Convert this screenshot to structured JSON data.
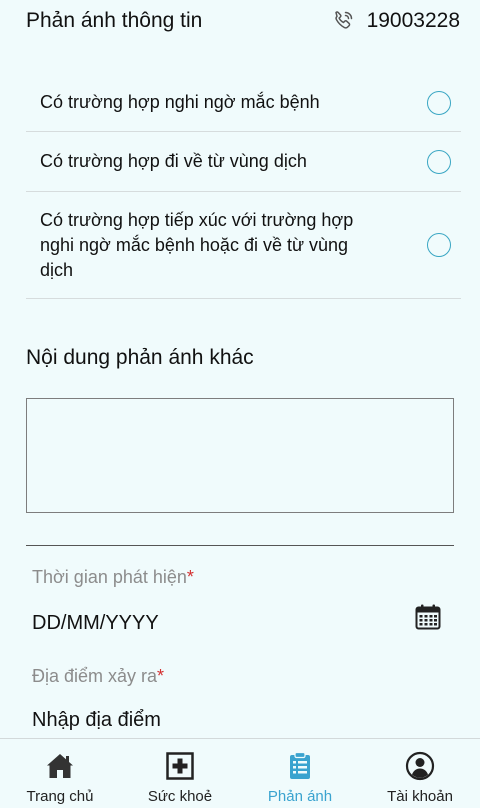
{
  "header": {
    "title": "Phản ánh thông tin",
    "phone_number": "19003228"
  },
  "options": [
    {
      "label": "Có trường hợp nghi ngờ mắc bệnh",
      "checked": false
    },
    {
      "label": "Có trường hợp đi về từ vùng dịch",
      "checked": false
    },
    {
      "label": "Có trường hợp tiếp xúc với trường hợp nghi ngờ mắc bệnh hoặc đi về từ vùng dịch",
      "checked": false
    }
  ],
  "other_content": {
    "title": "Nội dung phản ánh khác",
    "value": ""
  },
  "detection_time": {
    "label": "Thời gian phát hiện",
    "required_mark": "*",
    "placeholder": "DD/MM/YYYY"
  },
  "location": {
    "label": "Địa điểm xảy ra",
    "required_mark": "*",
    "placeholder": "Nhập địa điểm"
  },
  "bottom_nav": {
    "items": [
      {
        "label": "Trang chủ",
        "icon": "home-icon",
        "active": false
      },
      {
        "label": "Sức khoẻ",
        "icon": "medical-cross-icon",
        "active": false
      },
      {
        "label": "Phản ánh",
        "icon": "clipboard-icon",
        "active": true
      },
      {
        "label": "Tài khoản",
        "icon": "user-icon",
        "active": false
      }
    ]
  },
  "colors": {
    "background": "#f0fbfc",
    "accent": "#3aa3cf",
    "required": "#d32f2f",
    "muted_text": "#8c8c8c"
  }
}
